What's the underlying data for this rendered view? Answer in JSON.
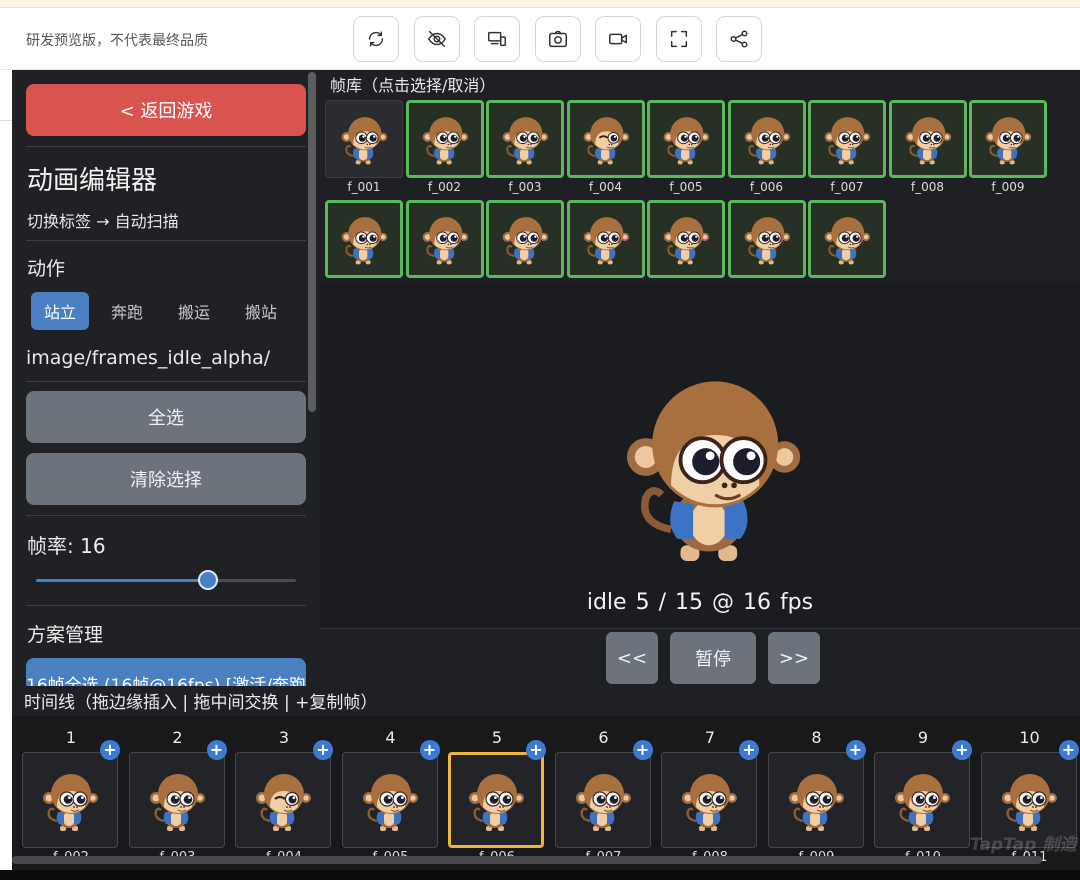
{
  "toolbar": {
    "notice": "研发预览版，不代表最终品质",
    "buttons": [
      {
        "name": "refresh-button",
        "icon": "refresh-icon"
      },
      {
        "name": "hide-button",
        "icon": "eye-off-icon"
      },
      {
        "name": "device-button",
        "icon": "devices-icon"
      },
      {
        "name": "screenshot-button",
        "icon": "camera-icon"
      },
      {
        "name": "record-button",
        "icon": "video-icon"
      },
      {
        "name": "fullscreen-button",
        "icon": "fullscreen-icon"
      },
      {
        "name": "share-button",
        "icon": "share-icon"
      }
    ]
  },
  "sidebar": {
    "back_label": "< 返回游戏",
    "title": "动画编辑器",
    "subtitle": "切换标签 → 自动扫描",
    "action_heading": "动作",
    "tabs": [
      {
        "label": "站立",
        "active": true
      },
      {
        "label": "奔跑",
        "active": false
      },
      {
        "label": "搬运",
        "active": false
      },
      {
        "label": "搬站",
        "active": false
      }
    ],
    "path": "image/frames_idle_alpha/",
    "select_all": "全选",
    "clear_selection": "清除选择",
    "fps_label": "帧率: 16",
    "fps_fraction": 0.66,
    "plan_heading": "方案管理",
    "plan_item": "16帧全选 (16帧@16fps) [激活/奔跑"
  },
  "library": {
    "label": "帧库（点击选择/取消）",
    "frames": [
      {
        "id": "f_001",
        "selected": false,
        "wink": false
      },
      {
        "id": "f_002",
        "selected": true,
        "wink": false
      },
      {
        "id": "f_003",
        "selected": true,
        "wink": false
      },
      {
        "id": "f_004",
        "selected": true,
        "wink": true
      },
      {
        "id": "f_005",
        "selected": true,
        "wink": false
      },
      {
        "id": "f_006",
        "selected": true,
        "wink": false
      },
      {
        "id": "f_007",
        "selected": true,
        "wink": false
      },
      {
        "id": "f_008",
        "selected": true,
        "wink": false
      },
      {
        "id": "f_009",
        "selected": true,
        "wink": false
      },
      {
        "id": "",
        "selected": true,
        "wink": false
      },
      {
        "id": "",
        "selected": true,
        "wink": false
      },
      {
        "id": "",
        "selected": true,
        "wink": false
      },
      {
        "id": "",
        "selected": true,
        "wink": false
      },
      {
        "id": "",
        "selected": true,
        "wink": false
      },
      {
        "id": "",
        "selected": true,
        "wink": false
      },
      {
        "id": "",
        "selected": true,
        "wink": false
      }
    ]
  },
  "preview": {
    "status": "idle  5 / 15  @ 16 fps",
    "prev": "<<",
    "pause": "暂停",
    "next": ">>"
  },
  "timeline": {
    "label": "时间线（拖边缘插入 | 拖中间交换 | +复制帧）",
    "plus": "+",
    "active_index": 4,
    "items": [
      {
        "num": "1",
        "frame": "f_002",
        "wink": false
      },
      {
        "num": "2",
        "frame": "f_003",
        "wink": false
      },
      {
        "num": "3",
        "frame": "f_004",
        "wink": true
      },
      {
        "num": "4",
        "frame": "f_005",
        "wink": false
      },
      {
        "num": "5",
        "frame": "f_006",
        "wink": false
      },
      {
        "num": "6",
        "frame": "f_007",
        "wink": false
      },
      {
        "num": "7",
        "frame": "f_008",
        "wink": false
      },
      {
        "num": "8",
        "frame": "f_009",
        "wink": false
      },
      {
        "num": "9",
        "frame": "f_010",
        "wink": false
      },
      {
        "num": "10",
        "frame": "f_011",
        "wink": false
      }
    ]
  },
  "watermark": "TapTap 制造",
  "colors": {
    "accent_blue": "#4a7fc1",
    "back_red": "#d9534f",
    "selected_green": "#5cb85c",
    "active_orange": "#f0b541"
  }
}
